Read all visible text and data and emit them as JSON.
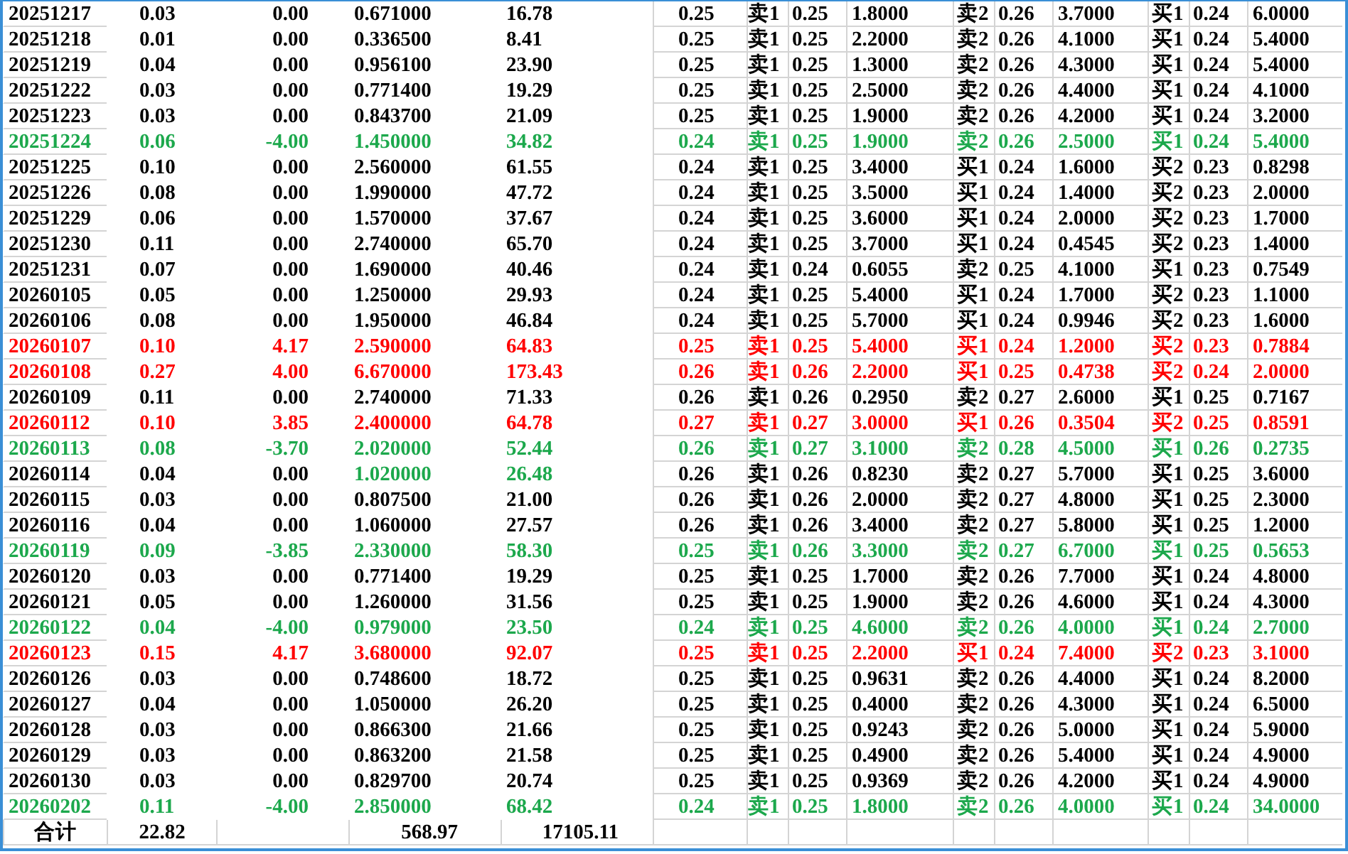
{
  "rows": [
    {
      "color": "#000000",
      "cells": [
        "20251217",
        "0.03",
        "0.00",
        "0.671000",
        "16.78",
        "0.25",
        "卖1",
        "0.25",
        "1.8000",
        "卖2",
        "0.26",
        "3.7000",
        "买1",
        "0.24",
        "6.0000"
      ]
    },
    {
      "color": "#000000",
      "cells": [
        "20251218",
        "0.01",
        "0.00",
        "0.336500",
        "8.41",
        "0.25",
        "卖1",
        "0.25",
        "2.2000",
        "卖2",
        "0.26",
        "4.1000",
        "买1",
        "0.24",
        "5.4000"
      ]
    },
    {
      "color": "#000000",
      "cells": [
        "20251219",
        "0.04",
        "0.00",
        "0.956100",
        "23.90",
        "0.25",
        "卖1",
        "0.25",
        "1.3000",
        "卖2",
        "0.26",
        "4.3000",
        "买1",
        "0.24",
        "5.4000"
      ]
    },
    {
      "color": "#000000",
      "cells": [
        "20251222",
        "0.03",
        "0.00",
        "0.771400",
        "19.29",
        "0.25",
        "卖1",
        "0.25",
        "2.5000",
        "卖2",
        "0.26",
        "4.4000",
        "买1",
        "0.24",
        "4.1000"
      ]
    },
    {
      "color": "#000000",
      "cells": [
        "20251223",
        "0.03",
        "0.00",
        "0.843700",
        "21.09",
        "0.25",
        "卖1",
        "0.25",
        "1.9000",
        "卖2",
        "0.26",
        "4.2000",
        "买1",
        "0.24",
        "3.2000"
      ]
    },
    {
      "color": "#1ca84c",
      "cells": [
        "20251224",
        "0.06",
        "-4.00",
        "1.450000",
        "34.82",
        "0.24",
        "卖1",
        "0.25",
        "1.9000",
        "卖2",
        "0.26",
        "2.5000",
        "买1",
        "0.24",
        "5.4000"
      ]
    },
    {
      "color": "#000000",
      "cells": [
        "20251225",
        "0.10",
        "0.00",
        "2.560000",
        "61.55",
        "0.24",
        "卖1",
        "0.25",
        "3.4000",
        "买1",
        "0.24",
        "1.6000",
        "买2",
        "0.23",
        "0.8298"
      ]
    },
    {
      "color": "#000000",
      "cells": [
        "20251226",
        "0.08",
        "0.00",
        "1.990000",
        "47.72",
        "0.24",
        "卖1",
        "0.25",
        "3.5000",
        "买1",
        "0.24",
        "1.4000",
        "买2",
        "0.23",
        "2.0000"
      ]
    },
    {
      "color": "#000000",
      "cells": [
        "20251229",
        "0.06",
        "0.00",
        "1.570000",
        "37.67",
        "0.24",
        "卖1",
        "0.25",
        "3.6000",
        "买1",
        "0.24",
        "2.0000",
        "买2",
        "0.23",
        "1.7000"
      ]
    },
    {
      "color": "#000000",
      "cells": [
        "20251230",
        "0.11",
        "0.00",
        "2.740000",
        "65.70",
        "0.24",
        "卖1",
        "0.25",
        "3.7000",
        "买1",
        "0.24",
        "0.4545",
        "买2",
        "0.23",
        "1.4000"
      ]
    },
    {
      "color": "#000000",
      "cells": [
        "20251231",
        "0.07",
        "0.00",
        "1.690000",
        "40.46",
        "0.24",
        "卖1",
        "0.24",
        "0.6055",
        "卖2",
        "0.25",
        "4.1000",
        "买1",
        "0.23",
        "0.7549"
      ]
    },
    {
      "color": "#000000",
      "cells": [
        "20260105",
        "0.05",
        "0.00",
        "1.250000",
        "29.93",
        "0.24",
        "卖1",
        "0.25",
        "5.4000",
        "买1",
        "0.24",
        "1.7000",
        "买2",
        "0.23",
        "1.1000"
      ]
    },
    {
      "color": "#000000",
      "cells": [
        "20260106",
        "0.08",
        "0.00",
        "1.950000",
        "46.84",
        "0.24",
        "卖1",
        "0.25",
        "5.7000",
        "买1",
        "0.24",
        "0.9946",
        "买2",
        "0.23",
        "1.6000"
      ]
    },
    {
      "color": "#ff0000",
      "cells": [
        "20260107",
        "0.10",
        "4.17",
        "2.590000",
        "64.83",
        "0.25",
        "卖1",
        "0.25",
        "5.4000",
        "买1",
        "0.24",
        "1.2000",
        "买2",
        "0.23",
        "0.7884"
      ]
    },
    {
      "color": "#ff0000",
      "cells": [
        "20260108",
        "0.27",
        "4.00",
        "6.670000",
        "173.43",
        "0.26",
        "卖1",
        "0.26",
        "2.2000",
        "买1",
        "0.25",
        "0.4738",
        "买2",
        "0.24",
        "2.0000"
      ]
    },
    {
      "color": "#000000",
      "cells": [
        "20260109",
        "0.11",
        "0.00",
        "2.740000",
        "71.33",
        "0.26",
        "卖1",
        "0.26",
        "0.2950",
        "卖2",
        "0.27",
        "2.6000",
        "买1",
        "0.25",
        "0.7167"
      ]
    },
    {
      "color": "#ff0000",
      "cells": [
        "20260112",
        "0.10",
        "3.85",
        "2.400000",
        "64.78",
        "0.27",
        "卖1",
        "0.27",
        "3.0000",
        "买1",
        "0.26",
        "0.3504",
        "买2",
        "0.25",
        "0.8591"
      ]
    },
    {
      "color": "#1ca84c",
      "cells": [
        "20260113",
        "0.08",
        "-3.70",
        "2.020000",
        "52.44",
        "0.26",
        "卖1",
        "0.27",
        "3.1000",
        "卖2",
        "0.28",
        "4.5000",
        "买1",
        "0.26",
        "0.2735"
      ]
    },
    {
      "color": "#000000",
      "cells": [
        "20260114",
        "0.04",
        "0.00",
        {
          "text": "1.020000",
          "color": "#1ca84c"
        },
        {
          "text": "26.48",
          "color": "#1ca84c"
        },
        "0.26",
        "卖1",
        "0.26",
        "0.8230",
        "卖2",
        "0.27",
        "5.7000",
        "买1",
        "0.25",
        "3.6000"
      ]
    },
    {
      "color": "#000000",
      "cells": [
        "20260115",
        "0.03",
        "0.00",
        "0.807500",
        "21.00",
        "0.26",
        "卖1",
        "0.26",
        "2.0000",
        "卖2",
        "0.27",
        "4.8000",
        "买1",
        "0.25",
        "2.3000"
      ]
    },
    {
      "color": "#000000",
      "cells": [
        "20260116",
        "0.04",
        "0.00",
        "1.060000",
        "27.57",
        "0.26",
        "卖1",
        "0.26",
        "3.4000",
        "卖2",
        "0.27",
        "5.8000",
        "买1",
        "0.25",
        "1.2000"
      ]
    },
    {
      "color": "#1ca84c",
      "cells": [
        "20260119",
        "0.09",
        "-3.85",
        "2.330000",
        "58.30",
        "0.25",
        "卖1",
        "0.26",
        "3.3000",
        "卖2",
        "0.27",
        "6.7000",
        "买1",
        "0.25",
        "0.5653"
      ]
    },
    {
      "color": "#000000",
      "cells": [
        "20260120",
        "0.03",
        "0.00",
        "0.771400",
        "19.29",
        "0.25",
        "卖1",
        "0.25",
        "1.7000",
        "卖2",
        "0.26",
        "7.7000",
        "买1",
        "0.24",
        "4.8000"
      ]
    },
    {
      "color": "#000000",
      "cells": [
        "20260121",
        "0.05",
        "0.00",
        "1.260000",
        "31.56",
        "0.25",
        "卖1",
        "0.25",
        "1.9000",
        "卖2",
        "0.26",
        "4.6000",
        "买1",
        "0.24",
        "4.3000"
      ]
    },
    {
      "color": "#1ca84c",
      "cells": [
        "20260122",
        "0.04",
        "-4.00",
        "0.979000",
        "23.50",
        "0.24",
        "卖1",
        "0.25",
        "4.6000",
        "卖2",
        "0.26",
        "4.0000",
        "买1",
        "0.24",
        "2.7000"
      ]
    },
    {
      "color": "#ff0000",
      "cells": [
        "20260123",
        "0.15",
        "4.17",
        "3.680000",
        "92.07",
        "0.25",
        "卖1",
        "0.25",
        "2.2000",
        "买1",
        "0.24",
        "7.4000",
        "买2",
        "0.23",
        "3.1000"
      ]
    },
    {
      "color": "#000000",
      "cells": [
        "20260126",
        "0.03",
        "0.00",
        "0.748600",
        "18.72",
        "0.25",
        "卖1",
        "0.25",
        "0.9631",
        "卖2",
        "0.26",
        "4.4000",
        "买1",
        "0.24",
        "8.2000"
      ]
    },
    {
      "color": "#000000",
      "cells": [
        "20260127",
        "0.04",
        "0.00",
        "1.050000",
        "26.20",
        "0.25",
        "卖1",
        "0.25",
        "0.4000",
        "卖2",
        "0.26",
        "4.3000",
        "买1",
        "0.24",
        "6.5000"
      ]
    },
    {
      "color": "#000000",
      "cells": [
        "20260128",
        "0.03",
        "0.00",
        "0.866300",
        "21.66",
        "0.25",
        "卖1",
        "0.25",
        "0.9243",
        "卖2",
        "0.26",
        "5.0000",
        "买1",
        "0.24",
        "5.9000"
      ]
    },
    {
      "color": "#000000",
      "cells": [
        "20260129",
        "0.03",
        "0.00",
        "0.863200",
        "21.58",
        "0.25",
        "卖1",
        "0.25",
        "0.4900",
        "卖2",
        "0.26",
        "5.4000",
        "买1",
        "0.24",
        "4.9000"
      ]
    },
    {
      "color": "#000000",
      "cells": [
        "20260130",
        "0.03",
        "0.00",
        "0.829700",
        "20.74",
        "0.25",
        "卖1",
        "0.25",
        "0.9369",
        "卖2",
        "0.26",
        "4.2000",
        "买1",
        "0.24",
        "4.9000"
      ]
    },
    {
      "color": "#1ca84c",
      "cells": [
        "20260202",
        "0.11",
        "-4.00",
        "2.850000",
        "68.42",
        "0.24",
        "卖1",
        "0.25",
        "1.8000",
        "卖2",
        "0.26",
        "4.0000",
        "买1",
        "0.24",
        "34.0000"
      ]
    }
  ],
  "total": {
    "label": "合计",
    "column_2": "22.82",
    "column_4": "568.97",
    "column_5": "17105.11"
  }
}
